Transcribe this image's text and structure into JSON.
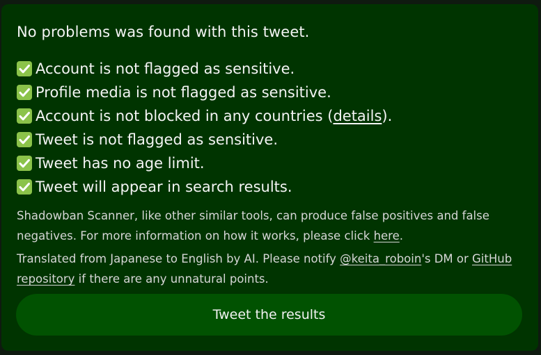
{
  "result": {
    "headline": "No problems was found with this tweet.",
    "checks": [
      "Account is not flagged as sensitive.",
      "Profile media is not flagged as sensitive.",
      "Tweet is not flagged as sensitive.",
      "Tweet has no age limit.",
      "Tweet will appear in search results."
    ],
    "blocked_check": {
      "prefix": "Account is not blocked in any countries (",
      "link": "details",
      "suffix": ")."
    }
  },
  "disclaimer": {
    "text": "Shadowban Scanner, like other similar tools, can produce false positives and false negatives. For more information on how it works, please click ",
    "link": "here",
    "suffix": "."
  },
  "translation_note": {
    "prefix": "Translated from Japanese to English by AI. Please notify ",
    "author_link": "@keita_roboin",
    "middle": "'s DM or ",
    "repo_link": "GitHub repository",
    "suffix": " if there are any unnatural points."
  },
  "button": {
    "label": "Tweet the results"
  },
  "icons": {
    "check": "check-box-icon"
  },
  "colors": {
    "card_background": "#003400",
    "button_background": "#015201",
    "check_icon": "#8bc34a"
  }
}
